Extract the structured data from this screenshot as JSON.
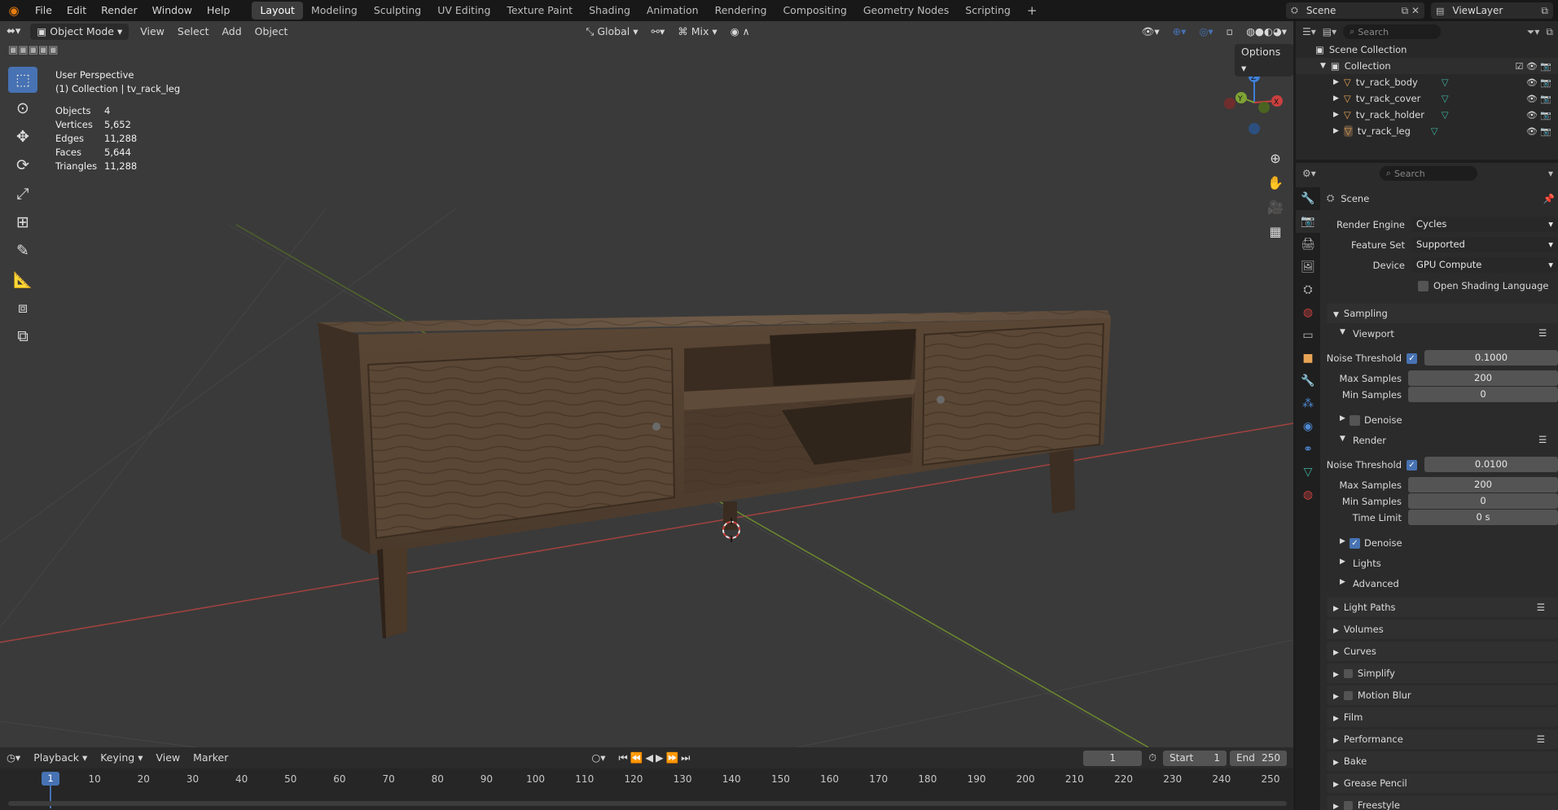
{
  "topbar": {
    "menus": [
      "File",
      "Edit",
      "Render",
      "Window",
      "Help"
    ],
    "workspaces": [
      "Layout",
      "Modeling",
      "Sculpting",
      "UV Editing",
      "Texture Paint",
      "Shading",
      "Animation",
      "Rendering",
      "Compositing",
      "Geometry Nodes",
      "Scripting"
    ],
    "active_workspace": "Layout",
    "scene": "Scene",
    "view_layer": "ViewLayer"
  },
  "viewport_header": {
    "mode": "Object Mode",
    "menus": [
      "View",
      "Select",
      "Add",
      "Object"
    ],
    "orientation": "Global",
    "snap": "Mix",
    "options": "Options"
  },
  "overlay": {
    "view_name": "User Perspective",
    "collection_line": "(1) Collection | tv_rack_leg",
    "stats": [
      {
        "label": "Objects",
        "value": "4"
      },
      {
        "label": "Vertices",
        "value": "5,652"
      },
      {
        "label": "Edges",
        "value": "11,288"
      },
      {
        "label": "Faces",
        "value": "5,644"
      },
      {
        "label": "Triangles",
        "value": "11,288"
      }
    ]
  },
  "timeline": {
    "menus": [
      "Playback",
      "Keying",
      "View",
      "Marker"
    ],
    "current_frame": "1",
    "start_label": "Start",
    "start": "1",
    "end_label": "End",
    "end": "250",
    "ticks": [
      "1",
      "10",
      "20",
      "30",
      "40",
      "50",
      "60",
      "70",
      "80",
      "90",
      "100",
      "110",
      "120",
      "130",
      "140",
      "150",
      "160",
      "170",
      "180",
      "190",
      "200",
      "210",
      "220",
      "230",
      "240",
      "250"
    ]
  },
  "outliner": {
    "search_placeholder": "Search",
    "scene_collection": "Scene Collection",
    "collection": "Collection",
    "objects": [
      "tv_rack_body",
      "tv_rack_cover",
      "tv_rack_holder",
      "tv_rack_leg"
    ]
  },
  "properties": {
    "search_placeholder": "Search",
    "context": "Scene",
    "render_engine_label": "Render Engine",
    "render_engine": "Cycles",
    "feature_set_label": "Feature Set",
    "feature_set": "Supported",
    "device_label": "Device",
    "device": "GPU Compute",
    "osl_label": "Open Shading Language",
    "sampling": "Sampling",
    "viewport": "Viewport",
    "noise_threshold_label": "Noise Threshold",
    "vp_noise": "0.1000",
    "max_samples_label": "Max Samples",
    "vp_max": "200",
    "min_samples_label": "Min Samples",
    "vp_min": "0",
    "denoise_label": "Denoise",
    "render": "Render",
    "r_noise": "0.0100",
    "r_max": "200",
    "r_min": "0",
    "time_limit_label": "Time Limit",
    "r_time": "0 s",
    "lights": "Lights",
    "advanced": "Advanced",
    "panels": [
      "Light Paths",
      "Volumes",
      "Curves",
      "Simplify",
      "Motion Blur",
      "Film",
      "Performance",
      "Bake",
      "Grease Pencil",
      "Freestyle"
    ]
  },
  "colors": {
    "accent": "#4772b3",
    "x_axis": "#c9403f",
    "y_axis": "#7fa334",
    "z_axis": "#3f7fd6"
  }
}
